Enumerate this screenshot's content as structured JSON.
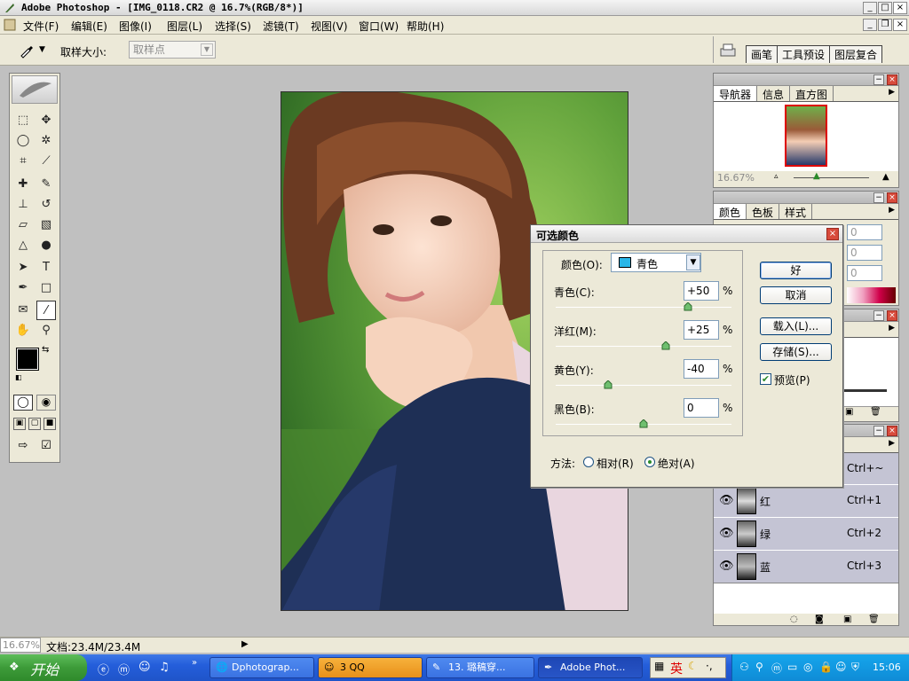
{
  "window": {
    "title": "Adobe Photoshop - [IMG_0118.CR2 @ 16.7%(RGB/8*)]",
    "min": "_",
    "max": "□",
    "close": "×",
    "doc_min": "_",
    "doc_restore": "❐",
    "doc_close": "×"
  },
  "menu": [
    "文件(F)",
    "编辑(E)",
    "图像(I)",
    "图层(L)",
    "选择(S)",
    "滤镜(T)",
    "视图(V)",
    "窗口(W)",
    "帮助(H)"
  ],
  "options": {
    "sample_size_label": "取样大小:",
    "sample_size_value": "取样点",
    "palette_tabs": [
      "画笔",
      "工具预设",
      "图层复合"
    ]
  },
  "navigator": {
    "tabs": [
      "导航器",
      "信息",
      "直方图"
    ],
    "zoom": "16.67%"
  },
  "color_palette": {
    "tabs": [
      "颜色",
      "色板",
      "样式"
    ],
    "values": [
      "0",
      "0",
      "0"
    ]
  },
  "channels": {
    "rows": [
      {
        "name": "",
        "shortcut": "Ctrl+~"
      },
      {
        "name": "红",
        "shortcut": "Ctrl+1"
      },
      {
        "name": "绿",
        "shortcut": "Ctrl+2"
      },
      {
        "name": "蓝",
        "shortcut": "Ctrl+3"
      }
    ]
  },
  "dialog": {
    "title": "可选颜色",
    "colors_label": "颜色(O):",
    "colors_value": "青色",
    "swatch_color": "#29b6e8",
    "sliders": [
      {
        "label": "青色(C):",
        "value": "+50",
        "unit": "%",
        "pos": 0.75
      },
      {
        "label": "洋红(M):",
        "value": "+25",
        "unit": "%",
        "pos": 0.625
      },
      {
        "label": "黄色(Y):",
        "value": "-40",
        "unit": "%",
        "pos": 0.3
      },
      {
        "label": "黑色(B):",
        "value": "0",
        "unit": "%",
        "pos": 0.5
      }
    ],
    "method_label": "方法:",
    "method_relative": "相对(R)",
    "method_absolute": "绝对(A)",
    "ok": "好",
    "cancel": "取消",
    "load": "载入(L)...",
    "save": "存储(S)...",
    "preview": "预览(P)"
  },
  "status": {
    "zoom": "16.67%",
    "doc": "文档:23.4M/23.4M"
  },
  "taskbar": {
    "start": "开始",
    "tasks": [
      "Dphotograp...",
      "3 QQ",
      "13. 璐稿穿...",
      "Adobe Phot..."
    ],
    "ime": "英",
    "clock": "15:06"
  }
}
